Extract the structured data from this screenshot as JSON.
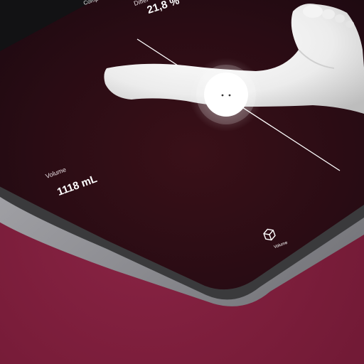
{
  "header": {
    "compare_tab": "Comp",
    "difference_label": "Differ",
    "difference_value": "21,8 %"
  },
  "measurements": {
    "volume_label": "Volume",
    "volume_value": "1118 mL"
  },
  "toolbar": {
    "volume_tab_label": "Volume",
    "volume_tab_icon": "cube-icon"
  },
  "colors": {
    "background": "#7c1f3d",
    "screen": "#1f0b11",
    "bezel": "#3a3a3c",
    "frame": "#9a9a9e",
    "accent": "#ffffff"
  }
}
